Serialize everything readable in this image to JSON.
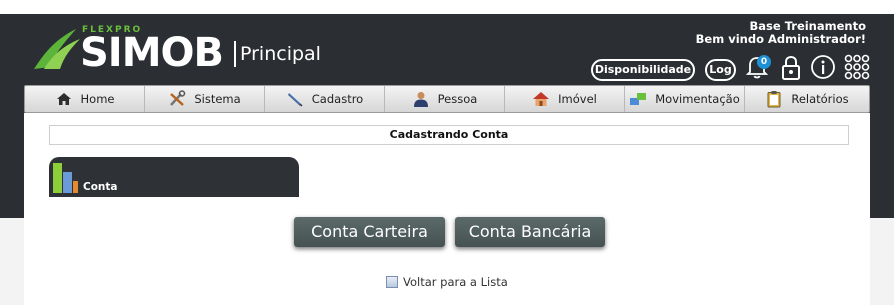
{
  "header": {
    "brand_top": "FLEXPRO",
    "brand_name": "SIMOB",
    "section": "Principal",
    "company": "Base Treinamento",
    "welcome": "Bem vindo Administrador!",
    "availability_label": "Disponibilidade",
    "log_label": "Log",
    "notification_count": "0"
  },
  "menu": {
    "items": [
      {
        "label": "Home",
        "icon": "home-icon"
      },
      {
        "label": "Sistema",
        "icon": "tools-icon"
      },
      {
        "label": "Cadastro",
        "icon": "pen-icon"
      },
      {
        "label": "Pessoa",
        "icon": "person-icon"
      },
      {
        "label": "Imóvel",
        "icon": "house-icon"
      },
      {
        "label": "Movimentação",
        "icon": "transfer-icon"
      },
      {
        "label": "Relatórios",
        "icon": "clipboard-icon"
      }
    ]
  },
  "content": {
    "title": "Cadastrando Conta",
    "tab_label": "Conta",
    "button_carteira": "Conta Carteira",
    "button_bancaria": "Conta Bancária",
    "back_link": "Voltar para a Lista"
  },
  "colors": {
    "header_bg": "#2b2e33",
    "brand_green": "#6abf3b",
    "button_bg": "#4f5c5c",
    "badge_blue": "#1e90d6"
  }
}
